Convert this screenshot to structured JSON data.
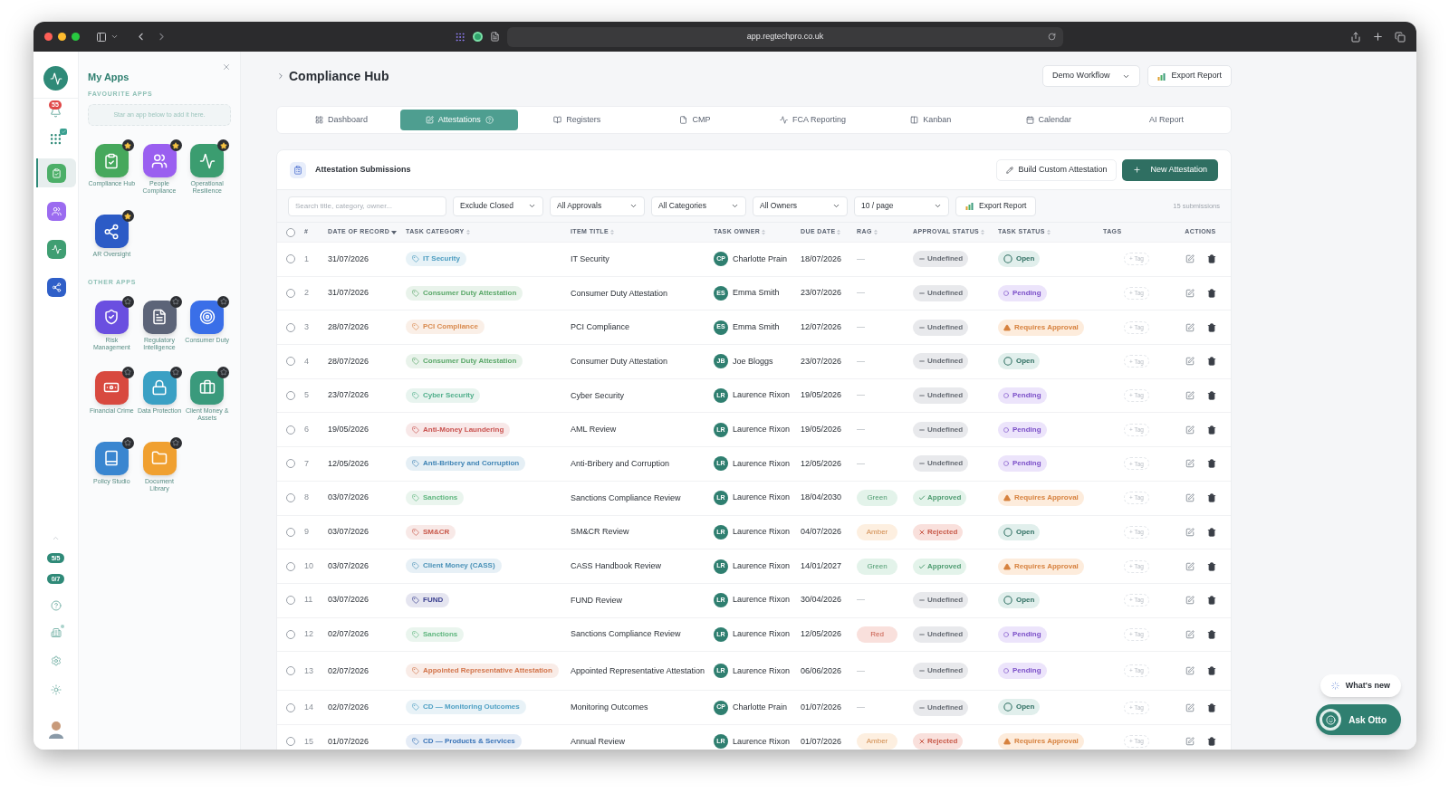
{
  "browser": {
    "url": "app.regtechpro.co.uk"
  },
  "rail": {
    "alerts_badge": "55",
    "apps": [
      {
        "color": "#4caf68",
        "selected": true,
        "kind": "clipboard"
      },
      {
        "color": "#9b6bf0",
        "selected": false,
        "kind": "people"
      },
      {
        "color": "#3f9e72",
        "selected": false,
        "kind": "pulse"
      },
      {
        "color": "#2f5fc8",
        "selected": false,
        "kind": "share"
      }
    ],
    "counters": [
      "5/5",
      "0/7"
    ]
  },
  "apps_panel": {
    "title": "My Apps",
    "favourites_heading": "FAVOURITE APPS",
    "favourites_hint": "Star an app below to add it here.",
    "favourites": [
      {
        "label": "Compliance Hub",
        "color": "#46a85c",
        "kind": "clipboard",
        "starred": true
      },
      {
        "label": "People Compliance",
        "color": "#9a5ff0",
        "kind": "people",
        "starred": true
      },
      {
        "label": "Operational Resilience",
        "color": "#3b9d70",
        "kind": "pulse",
        "starred": true
      },
      {
        "label": "AR Oversight",
        "color": "#2c5bc6",
        "kind": "share",
        "starred": true
      }
    ],
    "other_heading": "OTHER APPS",
    "others": [
      {
        "label": "Risk Management",
        "color": "#6a4fe0",
        "kind": "shield",
        "starred": false
      },
      {
        "label": "Regulatory Intelligence",
        "color": "#5c6478",
        "kind": "document",
        "starred": false
      },
      {
        "label": "Consumer Duty",
        "color": "#3a6fe8",
        "kind": "target",
        "starred": false
      },
      {
        "label": "Financial Crime",
        "color": "#d8493f",
        "kind": "banknote",
        "starred": false
      },
      {
        "label": "Data Protection",
        "color": "#3aa0c4",
        "kind": "lock",
        "starred": false
      },
      {
        "label": "Client Money & Assets",
        "color": "#3a9a7c",
        "kind": "briefcase",
        "starred": false
      },
      {
        "label": "Policy Studio",
        "color": "#3a86d0",
        "kind": "book",
        "starred": false
      },
      {
        "label": "Document Library",
        "color": "#f0a030",
        "kind": "folder",
        "starred": false
      }
    ]
  },
  "header": {
    "title": "Compliance Hub",
    "workflow": "Demo Workflow",
    "export": "Export Report"
  },
  "tabs": [
    {
      "label": "Dashboard",
      "kind": "grid",
      "selected": false
    },
    {
      "label": "Attestations",
      "kind": "check",
      "selected": true
    },
    {
      "label": "Registers",
      "kind": "book",
      "selected": false
    },
    {
      "label": "CMP",
      "kind": "file",
      "selected": false
    },
    {
      "label": "FCA Reporting",
      "kind": "pulse",
      "selected": false
    },
    {
      "label": "Kanban",
      "kind": "kanban",
      "selected": false
    },
    {
      "label": "Calendar",
      "kind": "calendar",
      "selected": false
    },
    {
      "label": "AI Report",
      "kind": "none",
      "selected": false
    }
  ],
  "card": {
    "title": "Attestation Submissions",
    "build": "Build Custom Attestation",
    "new": "New Attestation",
    "search_placeholder": "Search title, category, owner...",
    "filters": [
      "Exclude Closed",
      "All Approvals",
      "All Categories",
      "All Owners",
      "10 / page"
    ],
    "export": "Export Report",
    "count": "15 submissions"
  },
  "table": {
    "header_checked": false,
    "columns": [
      "#",
      "DATE OF RECORD",
      "TASK CATEGORY",
      "ITEM TITLE",
      "TASK OWNER",
      "DUE DATE",
      "RAG",
      "APPROVAL STATUS",
      "TASK STATUS",
      "TAGS",
      "ACTIONS"
    ],
    "rows": [
      {
        "checked": false,
        "num": "1",
        "date": "31/07/2026",
        "category": {
          "label": "IT Security",
          "color": "#4b9cc0"
        },
        "title": "IT Security",
        "owner_initials": "CP",
        "owner": "Charlotte Prain",
        "due": "18/07/2026",
        "rag": {
          "label": "—",
          "kind": "none"
        },
        "approval": {
          "label": "Undefined",
          "kind": "undefined"
        },
        "status": {
          "label": "Open",
          "kind": "open"
        },
        "tag": "+ Tag"
      },
      {
        "checked": false,
        "num": "2",
        "date": "31/07/2026",
        "category": {
          "label": "Consumer Duty Attestation",
          "color": "#5aa869"
        },
        "title": "Consumer Duty Attestation",
        "owner_initials": "ES",
        "owner": "Emma Smith",
        "due": "23/07/2026",
        "rag": {
          "label": "—",
          "kind": "none"
        },
        "approval": {
          "label": "Undefined",
          "kind": "undefined"
        },
        "status": {
          "label": "Pending",
          "kind": "pending"
        },
        "tag": "+ Tag"
      },
      {
        "checked": false,
        "num": "3",
        "date": "28/07/2026",
        "category": {
          "label": "PCI Compliance",
          "color": "#d98a4e"
        },
        "title": "PCI Compliance",
        "owner_initials": "ES",
        "owner": "Emma Smith",
        "due": "12/07/2026",
        "rag": {
          "label": "—",
          "kind": "none"
        },
        "approval": {
          "label": "Undefined",
          "kind": "undefined"
        },
        "status": {
          "label": "Requires Approval",
          "kind": "requires"
        },
        "tag": "+ Tag"
      },
      {
        "checked": false,
        "num": "4",
        "date": "28/07/2026",
        "category": {
          "label": "Consumer Duty Attestation",
          "color": "#5aa869"
        },
        "title": "Consumer Duty Attestation",
        "owner_initials": "JB",
        "owner": "Joe Bloggs",
        "due": "23/07/2026",
        "rag": {
          "label": "—",
          "kind": "none"
        },
        "approval": {
          "label": "Undefined",
          "kind": "undefined"
        },
        "status": {
          "label": "Open",
          "kind": "open"
        },
        "tag": "+ Tag"
      },
      {
        "checked": false,
        "num": "5",
        "date": "23/07/2026",
        "category": {
          "label": "Cyber Security",
          "color": "#4fae8a"
        },
        "title": "Cyber Security",
        "owner_initials": "LR",
        "owner": "Laurence Rixon",
        "due": "19/05/2026",
        "rag": {
          "label": "—",
          "kind": "none"
        },
        "approval": {
          "label": "Undefined",
          "kind": "undefined"
        },
        "status": {
          "label": "Pending",
          "kind": "pending"
        },
        "tag": "+ Tag"
      },
      {
        "checked": false,
        "num": "6",
        "date": "19/05/2026",
        "category": {
          "label": "Anti-Money Laundering",
          "color": "#c9524f"
        },
        "title": "AML Review",
        "owner_initials": "LR",
        "owner": "Laurence Rixon",
        "due": "19/05/2026",
        "rag": {
          "label": "—",
          "kind": "none"
        },
        "approval": {
          "label": "Undefined",
          "kind": "undefined"
        },
        "status": {
          "label": "Pending",
          "kind": "pending"
        },
        "tag": "+ Tag"
      },
      {
        "checked": false,
        "num": "7",
        "date": "12/05/2026",
        "category": {
          "label": "Anti-Bribery and Corruption",
          "color": "#3f84b5"
        },
        "title": "Anti-Bribery and Corruption",
        "owner_initials": "LR",
        "owner": "Laurence Rixon",
        "due": "12/05/2026",
        "rag": {
          "label": "—",
          "kind": "none"
        },
        "approval": {
          "label": "Undefined",
          "kind": "undefined"
        },
        "status": {
          "label": "Pending",
          "kind": "pending"
        },
        "tag": "+ Tag"
      },
      {
        "checked": false,
        "num": "8",
        "date": "03/07/2026",
        "category": {
          "label": "Sanctions",
          "color": "#5fb67e"
        },
        "title": "Sanctions Compliance Review",
        "owner_initials": "LR",
        "owner": "Laurence Rixon",
        "due": "18/04/2030",
        "rag": {
          "label": "Green",
          "kind": "green"
        },
        "approval": {
          "label": "Approved",
          "kind": "approved"
        },
        "status": {
          "label": "Requires Approval",
          "kind": "requires"
        },
        "tag": "+ Tag"
      },
      {
        "checked": false,
        "num": "9",
        "date": "03/07/2026",
        "category": {
          "label": "SM&CR",
          "color": "#c8584a"
        },
        "title": "SM&CR Review",
        "owner_initials": "LR",
        "owner": "Laurence Rixon",
        "due": "04/07/2026",
        "rag": {
          "label": "Amber",
          "kind": "amber"
        },
        "approval": {
          "label": "Rejected",
          "kind": "rejected"
        },
        "status": {
          "label": "Open",
          "kind": "open"
        },
        "tag": "+ Tag"
      },
      {
        "checked": false,
        "num": "10",
        "date": "03/07/2026",
        "category": {
          "label": "Client Money (CASS)",
          "color": "#4b92b8"
        },
        "title": "CASS Handbook Review",
        "owner_initials": "LR",
        "owner": "Laurence Rixon",
        "due": "14/01/2027",
        "rag": {
          "label": "Green",
          "kind": "green"
        },
        "approval": {
          "label": "Approved",
          "kind": "approved"
        },
        "status": {
          "label": "Requires Approval",
          "kind": "requires"
        },
        "tag": "+ Tag"
      },
      {
        "checked": false,
        "num": "11",
        "date": "03/07/2026",
        "category": {
          "label": "FUND",
          "color": "#3a3f8f"
        },
        "title": "FUND Review",
        "owner_initials": "LR",
        "owner": "Laurence Rixon",
        "due": "30/04/2026",
        "rag": {
          "label": "—",
          "kind": "none"
        },
        "approval": {
          "label": "Undefined",
          "kind": "undefined"
        },
        "status": {
          "label": "Open",
          "kind": "open"
        },
        "tag": "+ Tag"
      },
      {
        "checked": false,
        "num": "12",
        "date": "02/07/2026",
        "category": {
          "label": "Sanctions",
          "color": "#5fb67e"
        },
        "title": "Sanctions Compliance Review",
        "owner_initials": "LR",
        "owner": "Laurence Rixon",
        "due": "12/05/2026",
        "rag": {
          "label": "Red",
          "kind": "red"
        },
        "approval": {
          "label": "Undefined",
          "kind": "undefined"
        },
        "status": {
          "label": "Pending",
          "kind": "pending"
        },
        "tag": "+ Tag"
      },
      {
        "checked": false,
        "num": "13",
        "date": "02/07/2026",
        "category": {
          "label": "Appointed Representative Attestation",
          "color": "#d2744a"
        },
        "title": "Appointed Representative Attestation",
        "owner_initials": "LR",
        "owner": "Laurence Rixon",
        "due": "06/06/2026",
        "rag": {
          "label": "—",
          "kind": "none"
        },
        "approval": {
          "label": "Undefined",
          "kind": "undefined"
        },
        "status": {
          "label": "Pending",
          "kind": "pending"
        },
        "tag": "+ Tag"
      },
      {
        "checked": false,
        "num": "14",
        "date": "02/07/2026",
        "category": {
          "label": "CD — Monitoring Outcomes",
          "color": "#4fa0c4"
        },
        "title": "Monitoring Outcomes",
        "owner_initials": "CP",
        "owner": "Charlotte Prain",
        "due": "01/07/2026",
        "rag": {
          "label": "—",
          "kind": "none"
        },
        "approval": {
          "label": "Undefined",
          "kind": "undefined"
        },
        "status": {
          "label": "Open",
          "kind": "open"
        },
        "tag": "+ Tag"
      },
      {
        "checked": false,
        "num": "15",
        "date": "01/07/2026",
        "category": {
          "label": "CD — Products & Services",
          "color": "#3a74b8"
        },
        "title": "Annual Review",
        "owner_initials": "LR",
        "owner": "Laurence Rixon",
        "due": "01/07/2026",
        "rag": {
          "label": "Amber",
          "kind": "amber"
        },
        "approval": {
          "label": "Rejected",
          "kind": "rejected"
        },
        "status": {
          "label": "Requires Approval",
          "kind": "requires"
        },
        "tag": "+ Tag"
      }
    ]
  },
  "floating": {
    "whats_new": "What's new",
    "ask": "Ask Otto"
  }
}
